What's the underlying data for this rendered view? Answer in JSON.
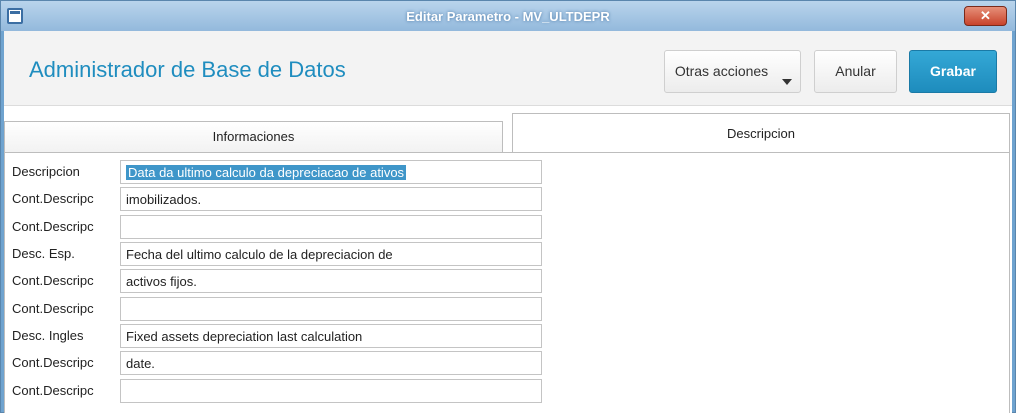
{
  "window": {
    "title": "Editar Parametro - MV_ULTDEPR",
    "close_label": "✕"
  },
  "header": {
    "title": "Administrador de Base de Datos",
    "buttons": {
      "otras": "Otras acciones",
      "anular": "Anular",
      "grabar": "Grabar"
    }
  },
  "tabs": [
    {
      "label": "Informaciones",
      "active": false
    },
    {
      "label": "Descripcion",
      "active": true
    }
  ],
  "form": {
    "rows": [
      {
        "label": "Descripcion",
        "value": "Data da ultimo calculo da depreciacao de ativos"
      },
      {
        "label": "Cont.Descripc",
        "value": "imobilizados."
      },
      {
        "label": "Cont.Descripc",
        "value": ""
      },
      {
        "label": "Desc. Esp.",
        "value": "Fecha del ultimo calculo de la depreciacion de"
      },
      {
        "label": "Cont.Descripc",
        "value": "activos fijos."
      },
      {
        "label": "Cont.Descripc",
        "value": ""
      },
      {
        "label": "Desc. Ingles",
        "value": "Fixed assets depreciation last calculation"
      },
      {
        "label": "Cont.Descripc",
        "value": "date."
      },
      {
        "label": "Cont.Descripc",
        "value": ""
      }
    ]
  },
  "colors": {
    "accent": "#1f8dbf",
    "primary_button": "#1e8cbd",
    "selection": "#3f96c9"
  }
}
